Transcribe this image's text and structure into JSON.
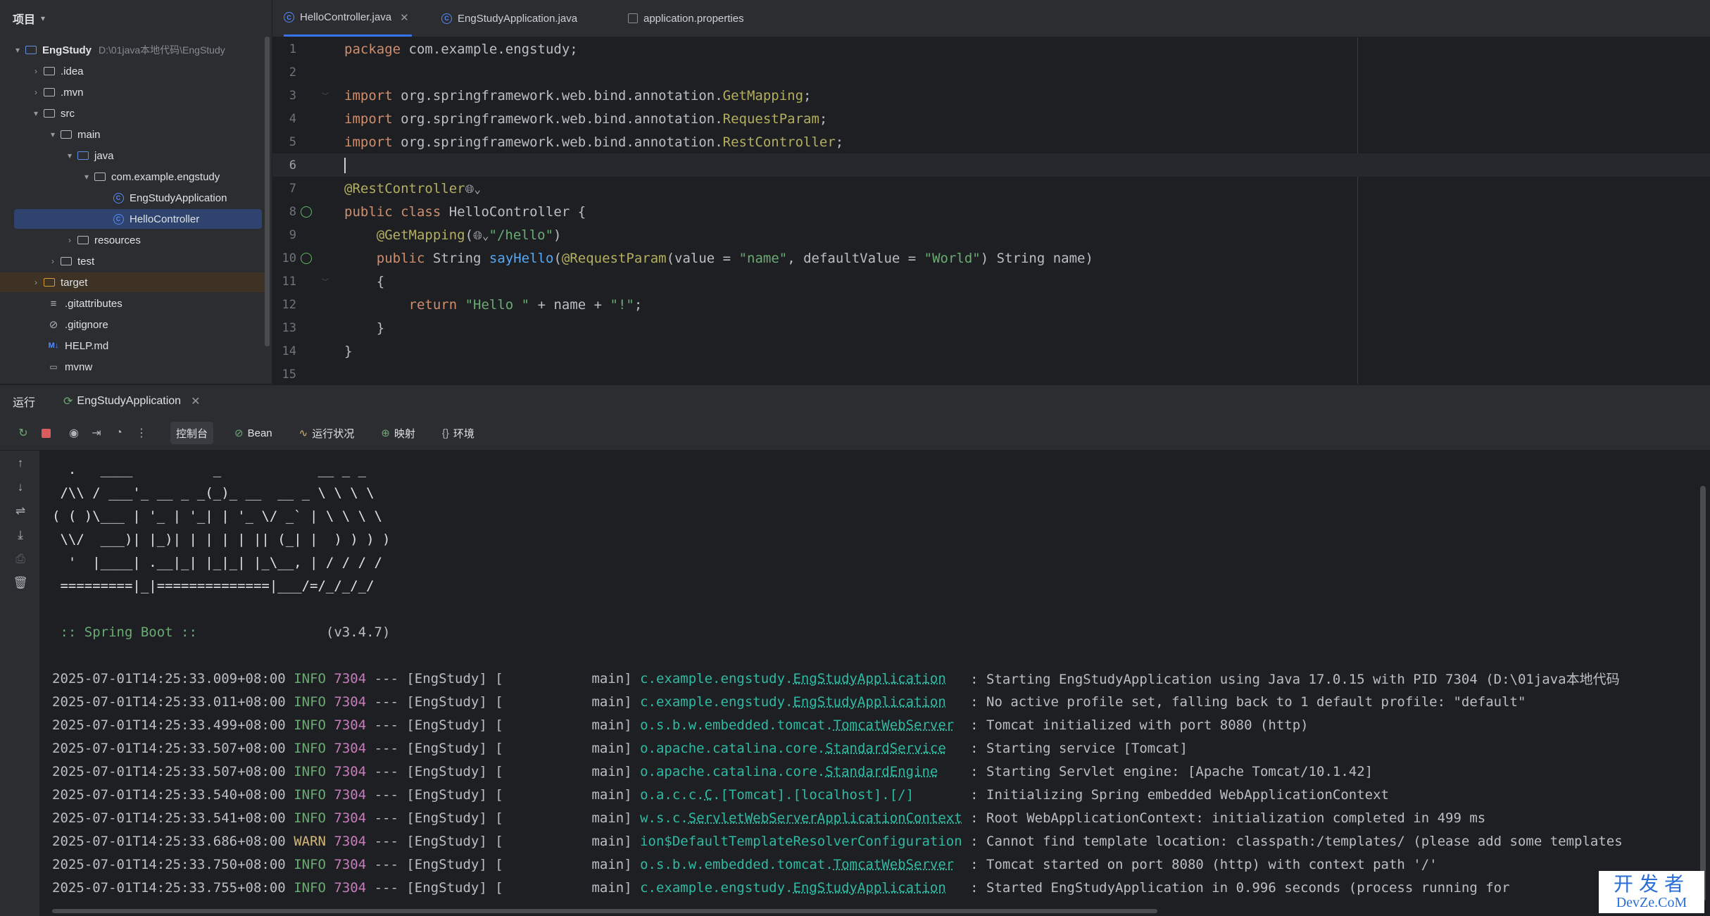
{
  "project_panel": {
    "title": "项目",
    "tree": [
      {
        "label": "EngStudy",
        "path": "D:\\01java本地代码\\EngStudy",
        "bold": true
      },
      {
        "label": ".idea"
      },
      {
        "label": ".mvn"
      },
      {
        "label": "src"
      },
      {
        "label": "main"
      },
      {
        "label": "java"
      },
      {
        "label": "com.example.engstudy"
      },
      {
        "label": "EngStudyApplication"
      },
      {
        "label": "HelloController"
      },
      {
        "label": "resources"
      },
      {
        "label": "test"
      },
      {
        "label": "target"
      },
      {
        "label": ".gitattributes"
      },
      {
        "label": ".gitignore"
      },
      {
        "label": "HELP.md"
      },
      {
        "label": "mvnw"
      }
    ]
  },
  "editor_tabs": [
    {
      "label": "HelloController.java",
      "active": true
    },
    {
      "label": "EngStudyApplication.java"
    },
    {
      "label": "application.properties"
    }
  ],
  "code_lines": [
    {
      "n": "1"
    },
    {
      "n": "2"
    },
    {
      "n": "3"
    },
    {
      "n": "4"
    },
    {
      "n": "5"
    },
    {
      "n": "6"
    },
    {
      "n": "7"
    },
    {
      "n": "8"
    },
    {
      "n": "9"
    },
    {
      "n": "10"
    },
    {
      "n": "11"
    },
    {
      "n": "12"
    },
    {
      "n": "13"
    },
    {
      "n": "14"
    },
    {
      "n": "15"
    }
  ],
  "code": {
    "l1_kw": "package",
    "l1_rest": " com.example.engstudy;",
    "l3_kw": "import",
    "l3_rest": " org.springframework.web.bind.annotation.",
    "l3_ann": "GetMapping",
    "l4_ann": "RequestParam",
    "l5_ann": "RestController",
    "l7_ann": "@RestController",
    "l8_kw": "public class",
    "l8_rest": " HelloController {",
    "l9_ann": "@GetMapping",
    "l9_str": "\"/hello\"",
    "l10_kw": "public",
    "l10_type": " String ",
    "l10_fn": "sayHello",
    "l10_ann": "@RequestParam",
    "l10_a": "(value = ",
    "l10_s1": "\"name\"",
    "l10_b": ", defaultValue = ",
    "l10_s2": "\"World\"",
    "l10_c": ") String name)",
    "l11": "{",
    "l12_kw": "return",
    "l12_s1": "\"Hello \"",
    "l12_mid": " + name + ",
    "l12_s2": "\"!\"",
    "l12_end": ";",
    "l13": "}",
    "l14": "}",
    "semicolon": ";",
    "paren_open": "(",
    "paren_close": ")",
    "indent4": "    ",
    "indent8": "        "
  },
  "run_panel": {
    "title": "运行",
    "config_tab": "EngStudyApplication",
    "tabs": [
      {
        "label": "控制台",
        "icon": "",
        "active": true
      },
      {
        "label": "Bean",
        "icon": "⊘"
      },
      {
        "label": "运行状况",
        "icon": "∿"
      },
      {
        "label": "映射",
        "icon": "⊕"
      },
      {
        "label": "环境",
        "icon": "{}"
      }
    ]
  },
  "console": {
    "banner": [
      "  .   ____          _            __ _ _",
      " /\\\\ / ___'_ __ _ _(_)_ __  __ _ \\ \\ \\ \\",
      "( ( )\\___ | '_ | '_| | '_ \\/ _` | \\ \\ \\ \\",
      " \\\\/  ___)| |_)| | | | | || (_| |  ) ) ) )",
      "  '  |____| .__|_| |_|_| |_\\__, | / / / /",
      " =========|_|==============|___/=/_/_/_/"
    ],
    "spring_label": " :: Spring Boot :: ",
    "spring_version": "               (v3.4.7)",
    "logs": [
      {
        "ts": "2025-07-01T14:25:33.009+08:00",
        "level": "INFO",
        "pid": "7304",
        "app": " --- [EngStudy] [           main] ",
        "logger_prefix": "c.example.engstudy.",
        "logger_name": "EngStudyApplication",
        "pad": "   ",
        "msg": ": Starting EngStudyApplication using Java 17.0.15 with PID 7304 (D:\\01java本地代码"
      },
      {
        "ts": "2025-07-01T14:25:33.011+08:00",
        "level": "INFO",
        "pid": "7304",
        "app": " --- [EngStudy] [           main] ",
        "logger_prefix": "c.example.engstudy.",
        "logger_name": "EngStudyApplication",
        "pad": "   ",
        "msg": ": No active profile set, falling back to 1 default profile: \"default\""
      },
      {
        "ts": "2025-07-01T14:25:33.499+08:00",
        "level": "INFO",
        "pid": "7304",
        "app": " --- [EngStudy] [           main] ",
        "logger_prefix": "o.s.b.w.embedded.tomcat.",
        "logger_name": "TomcatWebServer",
        "pad": "  ",
        "msg": ": Tomcat initialized with port 8080 (http)"
      },
      {
        "ts": "2025-07-01T14:25:33.507+08:00",
        "level": "INFO",
        "pid": "7304",
        "app": " --- [EngStudy] [           main] ",
        "logger_prefix": "o.apache.catalina.core.",
        "logger_name": "StandardService",
        "pad": "   ",
        "msg": ": Starting service [Tomcat]"
      },
      {
        "ts": "2025-07-01T14:25:33.507+08:00",
        "level": "INFO",
        "pid": "7304",
        "app": " --- [EngStudy] [           main] ",
        "logger_prefix": "o.apache.catalina.core.",
        "logger_name": "StandardEngine",
        "pad": "    ",
        "msg": ": Starting Servlet engine: [Apache Tomcat/10.1.42]"
      },
      {
        "ts": "2025-07-01T14:25:33.540+08:00",
        "level": "INFO",
        "pid": "7304",
        "app": " --- [EngStudy] [           main] ",
        "logger_prefix": "o.a.c.c.",
        "logger_name": "C",
        "logger_suffix": ".[Tomcat].[localhost].[/]",
        "pad": "       ",
        "msg": ": Initializing Spring embedded WebApplicationContext"
      },
      {
        "ts": "2025-07-01T14:25:33.541+08:00",
        "level": "INFO",
        "pid": "7304",
        "app": " --- [EngStudy] [           main] ",
        "logger_prefix": "w.s.c.",
        "logger_name": "ServletWebServerApplicationContext",
        "pad": " ",
        "msg": ": Root WebApplicationContext: initialization completed in 499 ms"
      },
      {
        "ts": "2025-07-01T14:25:33.686+08:00",
        "level": "WARN",
        "pid": "7304",
        "app": " --- [EngStudy] [           main] ",
        "logger_prefix": "ion$DefaultTemplateResolverConfiguration",
        "logger_name": "",
        "pad": " ",
        "msg": ": Cannot find template location: classpath:/templates/ (please add some templates"
      },
      {
        "ts": "2025-07-01T14:25:33.750+08:00",
        "level": "INFO",
        "pid": "7304",
        "app": " --- [EngStudy] [           main] ",
        "logger_prefix": "o.s.b.w.embedded.tomcat.",
        "logger_name": "TomcatWebServer",
        "pad": "  ",
        "msg": ": Tomcat started on port 8080 (http) with context path '/'"
      },
      {
        "ts": "2025-07-01T14:25:33.755+08:00",
        "level": "INFO",
        "pid": "7304",
        "app": " --- [EngStudy] [           main] ",
        "logger_prefix": "c.example.engstudy.",
        "logger_name": "EngStudyApplication",
        "pad": "   ",
        "msg": ": Started EngStudyApplication in 0.996 seconds (process running for"
      }
    ]
  },
  "watermark": {
    "line1": "开发者",
    "line2": "DevZe.CoM"
  },
  "colors": {
    "accent": "#3574f0",
    "keyword": "#cf8e6d",
    "annotation": "#b3ae60",
    "string": "#6aab73",
    "logger": "#2fbaa3",
    "pid": "#c77dbb",
    "warn": "#d5b778"
  }
}
